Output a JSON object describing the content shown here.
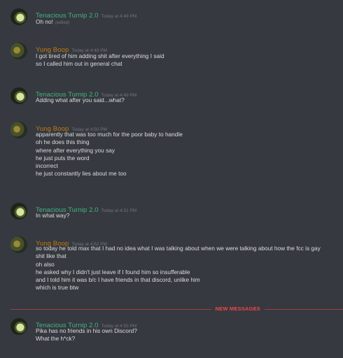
{
  "theme": {
    "background": "#36393f",
    "text": "#dcddde",
    "muted": "#72767d",
    "turnip_color": "#43b581",
    "boop_color": "#c27c0e",
    "new_messages_color": "#f04747"
  },
  "users": {
    "turnip": {
      "name": "Tenacious Turnip 2.0",
      "avatar": "green-plant-avatar"
    },
    "boop": {
      "name": "Yung Boop",
      "avatar": "olive-avatar"
    }
  },
  "messages": [
    {
      "author": "Tenacious Turnip 2.0",
      "timestamp": "Today at 4:49 PM",
      "lines": [
        "Oh no!"
      ],
      "edited": "(edited)"
    },
    {
      "author": "Yung Boop",
      "timestamp": "Today at 4:49 PM",
      "lines": [
        "I got tired of him adding shit after everything I said",
        "so I called him out in general chat"
      ]
    },
    {
      "author": "Tenacious Turnip 2.0",
      "timestamp": "Today at 4:49 PM",
      "lines": [
        "Adding what after you said...what?"
      ]
    },
    {
      "author": "Yung Boop",
      "timestamp": "Today at 4:50 PM",
      "lines": [
        "apparently that was too much for the poor baby to handle",
        "oh he does this thing",
        "where after everything you say",
        "he just puts the word",
        "incorrect",
        "he just constantly lies about me too"
      ]
    },
    {
      "author": "Tenacious Turnip 2.0",
      "timestamp": "Today at 4:51 PM",
      "lines": [
        "In what way?"
      ]
    },
    {
      "author": "Yung Boop",
      "timestamp": "Today at 4:52 PM",
      "lines": [
        "so today he told max that I had no idea what I was talking about when we were talking about how the fcc is gay",
        "shit like that",
        "oh also",
        "he asked why I didn't just leave if I found him so insufferable",
        "and I told him it was b/c I have friends in that discord, unlike him",
        "which is true btw"
      ]
    },
    {
      "author": "Tenacious Turnip 2.0",
      "timestamp": "Today at 4:55 PM",
      "lines": [
        "Pika has no friends in his own Discord?",
        "What the h*ck?"
      ]
    }
  ],
  "divider": {
    "label": "NEW MESSAGES"
  }
}
